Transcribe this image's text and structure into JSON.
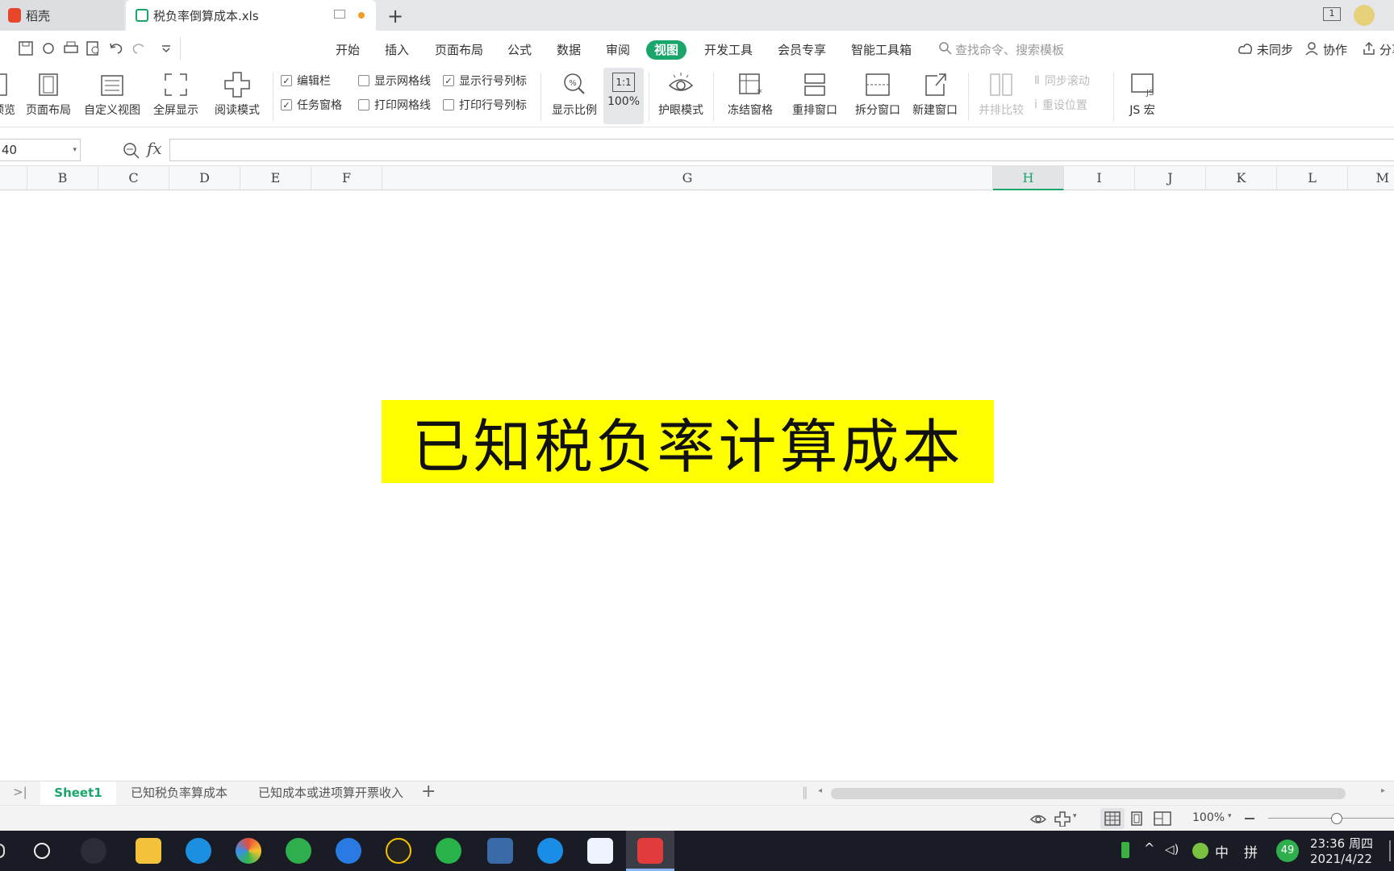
{
  "tabs": {
    "home_label": "稻壳",
    "file_label": "税负率倒算成本.xls"
  },
  "menu": [
    "开始",
    "插入",
    "页面布局",
    "公式",
    "数据",
    "审阅",
    "视图",
    "开发工具",
    "会员专享",
    "智能工具箱"
  ],
  "search": {
    "placeholder": "查找命令、搜索模板"
  },
  "right_actions": {
    "sync": "未同步",
    "collab": "协作",
    "share": "分享"
  },
  "ribbon": {
    "preview": "预览",
    "page_layout": "页面布局",
    "custom_view": "自定义视图",
    "fullscreen": "全屏显示",
    "read_mode": "阅读模式",
    "checks": {
      "edit_bar": "编辑栏",
      "task_pane": "任务窗格",
      "show_grid": "显示网格线",
      "print_grid": "打印网格线",
      "show_headers": "显示行号列标",
      "print_headers": "打印行号列标"
    },
    "zoom": "显示比例",
    "zoom_100": "100%",
    "zoom_100_icon": "1:1",
    "eye_mode": "护眼模式",
    "freeze": "冻结窗格",
    "arrange": "重排窗口",
    "split": "拆分窗口",
    "new_window": "新建窗口",
    "compare": "并排比较",
    "sync_scroll": "同步滚动",
    "reset_pos": "重设位置",
    "js_macro": "JS 宏"
  },
  "name_box": "40",
  "fx_label": "fx",
  "columns": [
    "B",
    "C",
    "D",
    "E",
    "F",
    "G",
    "H",
    "I",
    "J",
    "K",
    "L",
    "M"
  ],
  "cell_title": "已知税负率计算成本",
  "sheets": [
    "Sheet1",
    "已知税负率算成本",
    "已知成本或进项算开票收入"
  ],
  "status": {
    "zoom": "100%"
  },
  "clock": {
    "time": "23:36 周四",
    "date": "2021/4/22"
  },
  "tray": {
    "ime1": "中",
    "ime2": "拼",
    "badge": "49"
  },
  "colors": {
    "accent": "#1aa56b",
    "highlight": "#ffff00"
  }
}
